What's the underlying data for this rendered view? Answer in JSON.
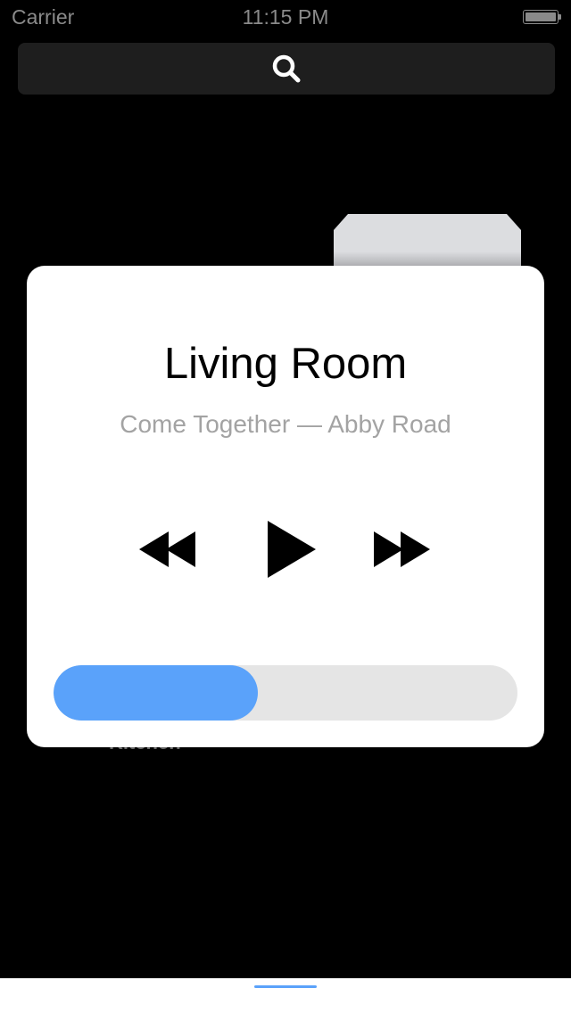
{
  "status_bar": {
    "carrier": "Carrier",
    "time": "11:15 PM",
    "battery_level": 1.0
  },
  "search": {
    "icon": "search-icon"
  },
  "background": {
    "partial_label": "Kitchen"
  },
  "player": {
    "room_name": "Living Room",
    "track_info": "Come Together — Abby Road",
    "controls": {
      "rewind_icon": "rewind-icon",
      "play_icon": "play-icon",
      "forward_icon": "fast-forward-icon"
    },
    "progress": 0.44
  },
  "bottom_bar": {
    "indicator": "tab-indicator"
  },
  "colors": {
    "background": "#000000",
    "card": "#ffffff",
    "accent": "#5aa2fa",
    "track_text": "#a3a3a3",
    "progress_track": "#e5e5e5"
  }
}
